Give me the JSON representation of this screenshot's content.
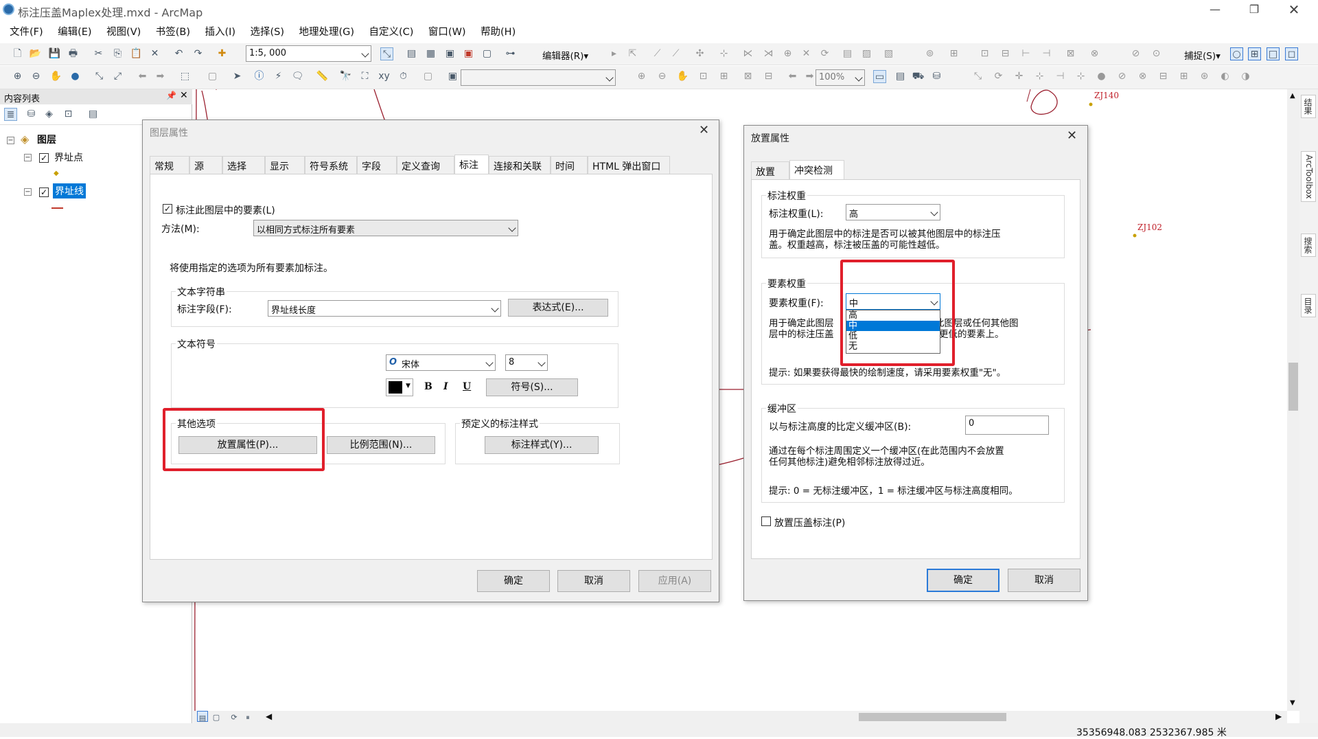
{
  "app": {
    "title": "标注压盖Maplex处理.mxd - ArcMap"
  },
  "menu": [
    "文件(F)",
    "编辑(E)",
    "视图(V)",
    "书签(B)",
    "插入(I)",
    "选择(S)",
    "地理处理(G)",
    "自定义(C)",
    "窗口(W)",
    "帮助(H)"
  ],
  "toolbar": {
    "scale": "1:5, 000",
    "editor": "编辑器(R)▾",
    "snapping": "捕捉(S)▾",
    "zoom": "100%"
  },
  "toc": {
    "header": "内容列表",
    "root": "图层",
    "layers": [
      {
        "name": "界址点",
        "checked": true
      },
      {
        "name": "界址线",
        "checked": true,
        "selected": true
      }
    ]
  },
  "map": {
    "labels": [
      "ZJ140",
      "ZJ102"
    ]
  },
  "sidepanel": [
    "结果",
    "ArcToolbox",
    "搜索",
    "目录"
  ],
  "status": {
    "coords": "35356948.083  2532367.985 米"
  },
  "layer_props": {
    "title": "图层属性",
    "tabs": [
      "常规",
      "源",
      "选择",
      "显示",
      "符号系统",
      "字段",
      "定义查询",
      "标注",
      "连接和关联",
      "时间",
      "HTML 弹出窗口"
    ],
    "active_tab": "标注",
    "label_check": "标注此图层中的要素(L)",
    "method_label": "方法(M):",
    "method_value": "以相同方式标注所有要素",
    "info": "将使用指定的选项为所有要素加标注。",
    "text_string_group": "文本字符串",
    "label_field_label": "标注字段(F):",
    "label_field_value": "界址线长度",
    "expression_btn": "表达式(E)...",
    "text_symbol_group": "文本符号",
    "font": "宋体",
    "font_size": "8",
    "bold": "B",
    "italic": "I",
    "underline": "U",
    "symbol_btn": "符号(S)...",
    "other_group": "其他选项",
    "placement_btn": "放置属性(P)...",
    "scale_btn": "比例范围(N)...",
    "predef_group": "预定义的标注样式",
    "label_style_btn": "标注样式(Y)...",
    "ok": "确定",
    "cancel": "取消",
    "apply": "应用(A)"
  },
  "placement_props": {
    "title": "放置属性",
    "tabs": [
      "放置",
      "冲突检测"
    ],
    "active_tab": "冲突检测",
    "label_weight_group": "标注权重",
    "label_weight_label": "标注权重(L):",
    "label_weight_value": "高",
    "label_weight_desc1": "用于确定此图层中的标注是否可以被其他图层中的标注压",
    "label_weight_desc2": "盖。权重越高，标注被压盖的可能性越低。",
    "feature_weight_group": "要素权重",
    "feature_weight_label": "要素权重(F):",
    "feature_weight_value": "中",
    "feature_weight_options": [
      "高",
      "中",
      "低",
      "无"
    ],
    "feature_weight_selected_index": 1,
    "feature_weight_desc1_a": "用于确定此图层",
    "feature_weight_desc1_b": "此图层或任何其他图",
    "feature_weight_desc2_a": "层中的标注压盖",
    "feature_weight_desc2_b": "更低的要素上。",
    "feature_weight_hint": "提示: 如果要获得最快的绘制速度，请采用要素权重\"无\"。",
    "buffer_group": "缓冲区",
    "buffer_label": "以与标注高度的比定义缓冲区(B):",
    "buffer_value": "0",
    "buffer_desc1": "通过在每个标注周围定义一个缓冲区(在此范围内不会放置",
    "buffer_desc2": "任何其他标注)避免相邻标注放得过近。",
    "buffer_hint": "提示: 0 = 无标注缓冲区，1 = 标注缓冲区与标注高度相同。",
    "overlap_check": "放置压盖标注(P)",
    "ok": "确定",
    "cancel": "取消"
  },
  "colors": {
    "accent": "#0078d7",
    "highlight_red": "#e01f2b",
    "map_line": "#9a1f2e"
  }
}
